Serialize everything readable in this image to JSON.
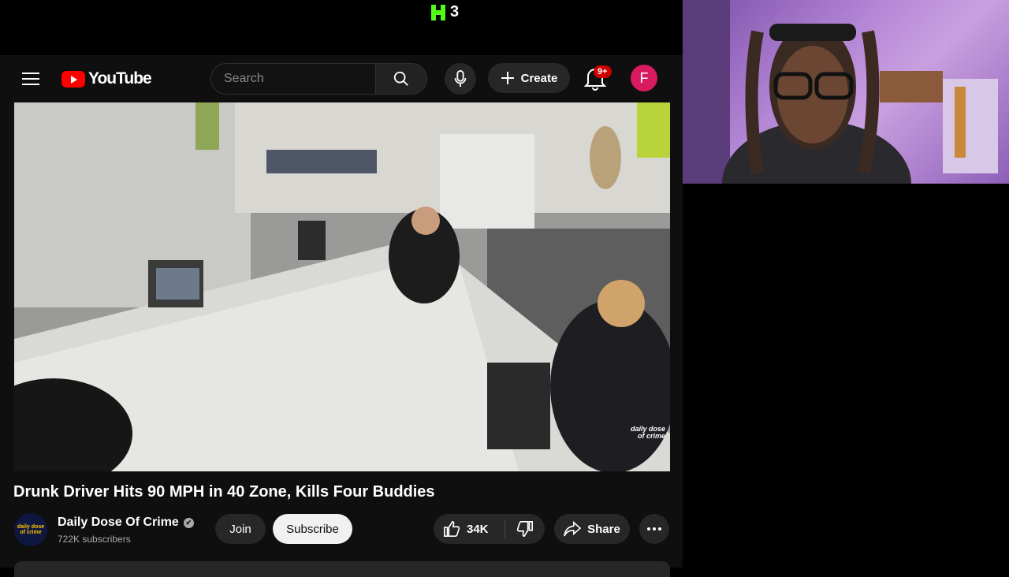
{
  "overlay": {
    "kick_count": "3",
    "colors": {
      "kick_green": "#53fc18"
    }
  },
  "youtube": {
    "brand": "YouTube",
    "search_placeholder": "Search",
    "create_label": "Create",
    "notifications_badge": "9+",
    "account_initial": "F",
    "colors": {
      "brand_red": "#ff0000",
      "avatar": "#d81b60"
    }
  },
  "video": {
    "title": "Drunk Driver Hits 90 MPH in 40 Zone, Kills Four Buddies",
    "watermark_line1": "daily dose",
    "watermark_line2": "of crime"
  },
  "channel": {
    "avatar_line1": "daily dose",
    "avatar_line2": "of crime",
    "name": "Daily Dose Of Crime",
    "verified_mark": "✔",
    "subscribers": "722K subscribers",
    "join_label": "Join",
    "subscribe_label": "Subscribe"
  },
  "actions": {
    "like_count": "34K",
    "share_label": "Share"
  }
}
